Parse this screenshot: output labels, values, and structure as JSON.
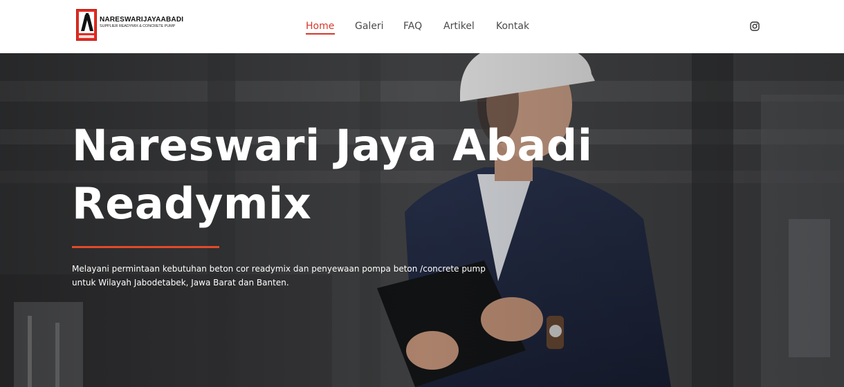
{
  "logo": {
    "title": "NARESWARIJAYAABADI",
    "subtitle": "SUPPLIER READYMIX & CONCRETE PUMP",
    "brand_color": "#e22b21"
  },
  "nav": {
    "items": [
      {
        "label": "Home",
        "active": true
      },
      {
        "label": "Galeri",
        "active": false
      },
      {
        "label": "FAQ",
        "active": false
      },
      {
        "label": "Artikel",
        "active": false
      },
      {
        "label": "Kontak",
        "active": false
      }
    ],
    "accent_color": "#d5382a",
    "social_icon": "instagram-icon"
  },
  "hero": {
    "title_line1": "Nareswari Jaya Abadi",
    "title_line2": "Readymix",
    "description": "Melayani permintaan kebutuhan beton cor readymix dan penyewaan pompa beton /concrete pump untuk Wilayah Jabodetabek, Jawa Barat dan Banten.",
    "rule_color": "#e24a2a"
  }
}
